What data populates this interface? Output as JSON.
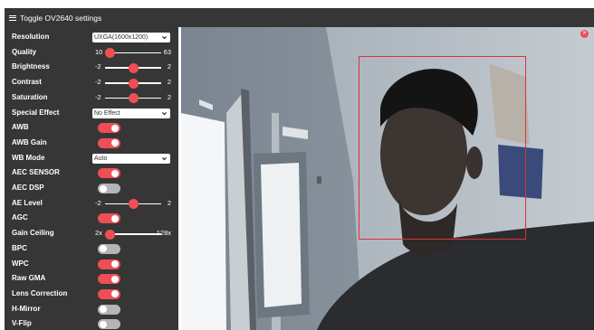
{
  "header": {
    "title": "Toggle OV2640 settings"
  },
  "controls": [
    {
      "type": "select",
      "label": "Resolution",
      "value": "UXGA(1600x1200)"
    },
    {
      "type": "range",
      "label": "Quality",
      "min": "10",
      "max": "63",
      "fraction": 0.0
    },
    {
      "type": "range",
      "label": "Brightness",
      "min": "-2",
      "max": "2",
      "fraction": 0.5
    },
    {
      "type": "range",
      "label": "Contrast",
      "min": "-2",
      "max": "2",
      "fraction": 0.5
    },
    {
      "type": "range",
      "label": "Saturation",
      "min": "-2",
      "max": "2",
      "fraction": 0.5
    },
    {
      "type": "select",
      "label": "Special Effect",
      "value": "No Effect"
    },
    {
      "type": "toggle",
      "label": "AWB",
      "on": true
    },
    {
      "type": "toggle",
      "label": "AWB Gain",
      "on": true
    },
    {
      "type": "select",
      "label": "WB Mode",
      "value": "Auto"
    },
    {
      "type": "toggle",
      "label": "AEC SENSOR",
      "on": true
    },
    {
      "type": "toggle",
      "label": "AEC DSP",
      "on": false
    },
    {
      "type": "range",
      "label": "AE Level",
      "min": "-2",
      "max": "2",
      "fraction": 0.5
    },
    {
      "type": "toggle",
      "label": "AGC",
      "on": true
    },
    {
      "type": "range",
      "label": "Gain Ceiling",
      "min": "2x",
      "max": "128x",
      "fraction": 0.0
    },
    {
      "type": "toggle",
      "label": "BPC",
      "on": false
    },
    {
      "type": "toggle",
      "label": "WPC",
      "on": true
    },
    {
      "type": "toggle",
      "label": "Raw GMA",
      "on": true
    },
    {
      "type": "toggle",
      "label": "Lens Correction",
      "on": true
    },
    {
      "type": "toggle",
      "label": "H-Mirror",
      "on": false
    },
    {
      "type": "toggle",
      "label": "V-Flip",
      "on": false
    }
  ],
  "stream": {
    "close_icon": "close-icon",
    "face_box_color": "#e0303c"
  },
  "colors": {
    "accent": "#ef4e56",
    "panel": "#363636",
    "toggle_off": "#b5b5b5"
  }
}
